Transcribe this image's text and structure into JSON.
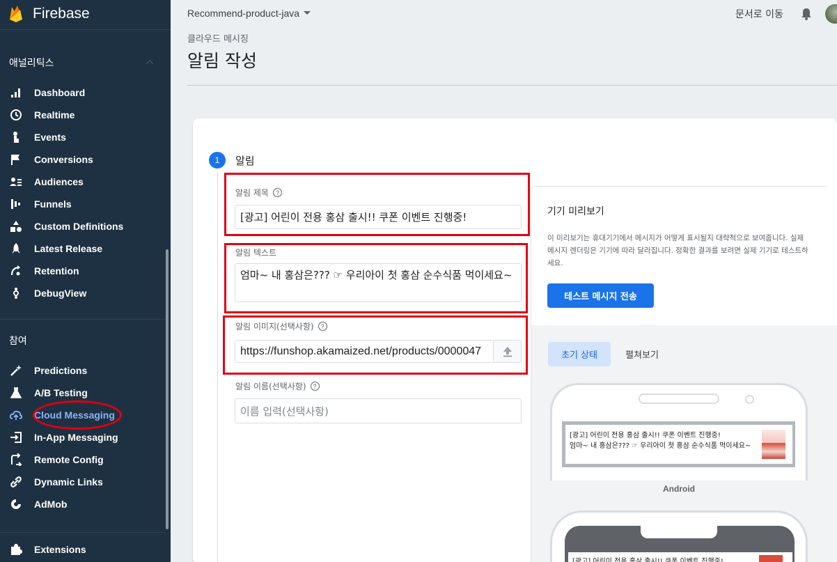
{
  "app": {
    "name": "Firebase"
  },
  "sidebar": {
    "analytics_title": "애널리틱스",
    "analytics_items": [
      {
        "label": "Dashboard",
        "icon": "bar-chart-icon"
      },
      {
        "label": "Realtime",
        "icon": "clock-icon"
      },
      {
        "label": "Events",
        "icon": "touch-icon"
      },
      {
        "label": "Conversions",
        "icon": "flag-icon"
      },
      {
        "label": "Audiences",
        "icon": "audience-icon"
      },
      {
        "label": "Funnels",
        "icon": "funnel-icon"
      },
      {
        "label": "Custom Definitions",
        "icon": "shapes-icon"
      },
      {
        "label": "Latest Release",
        "icon": "rocket-icon"
      },
      {
        "label": "Retention",
        "icon": "retention-icon"
      },
      {
        "label": "DebugView",
        "icon": "debug-icon"
      }
    ],
    "engage_title": "참여",
    "engage_items": [
      {
        "label": "Predictions",
        "icon": "wand-icon"
      },
      {
        "label": "A/B Testing",
        "icon": "flask-icon"
      },
      {
        "label": "Cloud Messaging",
        "icon": "cloud-icon"
      },
      {
        "label": "In-App Messaging",
        "icon": "inapp-icon"
      },
      {
        "label": "Remote Config",
        "icon": "config-icon"
      },
      {
        "label": "Dynamic Links",
        "icon": "link-icon"
      },
      {
        "label": "AdMob",
        "icon": "admob-icon"
      }
    ],
    "extensions_label": "Extensions"
  },
  "header": {
    "project": "Recommend-product-java",
    "docs": "문서로 이동",
    "breadcrumb": "클라우드 메시징",
    "title": "알림 작성"
  },
  "step": {
    "number": "1",
    "title": "알림"
  },
  "form": {
    "title_label": "알림 제목",
    "title_value": "[광고] 어린이 전용 홍삼 출시!! 쿠폰 이벤트 진행중!",
    "text_label": "알림 텍스트",
    "text_value": "엄마~ 내 홍삼은??? ☞ 우리아이 첫 홍삼 순수식품 먹이세요~",
    "image_label": "알림 이미지(선택사항)",
    "image_value": "https://funshop.akamaized.net/products/0000047",
    "name_label": "알림 이름(선택사항)",
    "name_placeholder": "이름 입력(선택사항)"
  },
  "preview": {
    "title": "기기 미리보기",
    "description": "이 미리보기는 휴대기기에서 메시지가 어떻게 표시될지 대략적으로 보여줍니다. 실제 메시지 렌더링은 기기에 따라 달라집니다. 정확한 결과를 보려면 실제 기기로 테스트하세요.",
    "test_button": "테스트 메시지 전송",
    "tab_initial": "초기 상태",
    "tab_expanded": "펼쳐보기",
    "notif_title": "[광고] 어린이 전용 홍삼 출시!! 쿠폰 이벤트 진행중!",
    "notif_text": "엄마~ 내 홍삼은??? ☞ 우리아이 첫 홍삼 순수식품 먹이세요~",
    "platform": "Android"
  },
  "colors": {
    "sidebar_bg": "#1e3142",
    "accent": "#1a73e8",
    "highlight": "#e00012",
    "active_nav": "#8ab4f8"
  }
}
